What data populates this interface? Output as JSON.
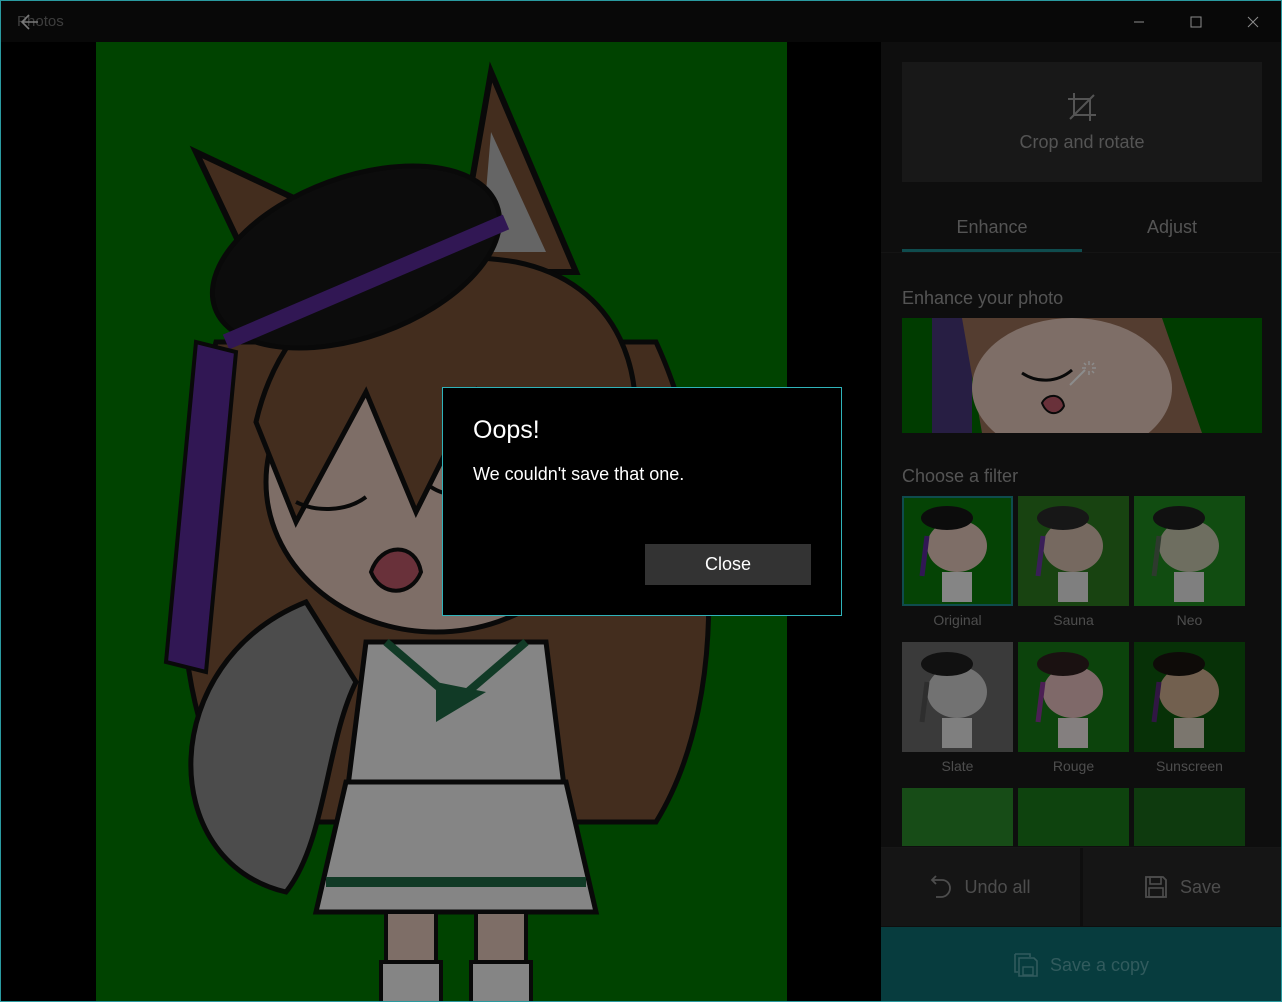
{
  "window": {
    "app_title": "Photos",
    "back_icon": "back-arrow-icon",
    "minimize_icon": "minimize-icon",
    "maximize_icon": "maximize-icon",
    "close_icon": "close-icon"
  },
  "colors": {
    "accent": "#1d8a8f",
    "panel_bg": "#1b1b1b",
    "photo_bg": "#007a00",
    "dialog_border": "#2fb3ba"
  },
  "panel": {
    "crop_rotate_label": "Crop and rotate",
    "crop_icon": "crop-icon",
    "tabs": [
      {
        "label": "Enhance",
        "active": true
      },
      {
        "label": "Adjust",
        "active": false
      }
    ],
    "enhance_label": "Enhance your photo",
    "enhance_icon": "magic-wand-icon",
    "filter_label": "Choose a filter",
    "filters": [
      {
        "name": "Original",
        "selected": true
      },
      {
        "name": "Sauna",
        "selected": false
      },
      {
        "name": "Neo",
        "selected": false
      },
      {
        "name": "Slate",
        "selected": false
      },
      {
        "name": "Rouge",
        "selected": false
      },
      {
        "name": "Sunscreen",
        "selected": false
      }
    ],
    "undo_label": "Undo all",
    "undo_icon": "undo-icon",
    "save_label": "Save",
    "save_icon": "floppy-disk-icon",
    "save_copy_label": "Save a copy",
    "save_copy_icon": "save-copy-icon"
  },
  "dialog": {
    "title": "Oops!",
    "message": "We couldn't save that one.",
    "close_label": "Close"
  }
}
